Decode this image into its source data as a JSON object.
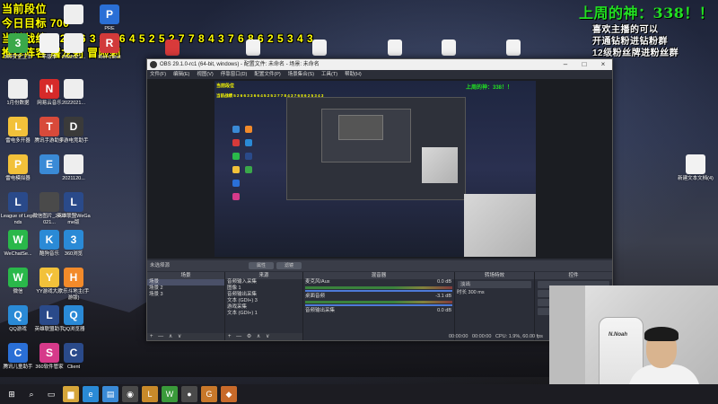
{
  "overlay": {
    "line1": "当前段位",
    "line2": "今日目标 700",
    "line3": "当前战绩 5 2 6 6 3 3 6 6 4 5 2 5 2 7 7 8 4 3 7 6 8 6 2 5 3 4 3",
    "line4": "推荐阵容 屠龙刺 冒险刺",
    "god_title": "上周的神：338！！",
    "right1": "喜欢主播的可以",
    "right2": "开通钻粉进钻粉群",
    "right3": "12级粉丝牌进粉丝群"
  },
  "desktop_icons": [
    {
      "name": "icon-pre",
      "label": "PRE",
      "color": "#2a6fd6",
      "glyph": "P"
    },
    {
      "name": "icon-doc-1",
      "label": "",
      "color": "#eeeeee",
      "glyph": ""
    },
    {
      "name": "icon-360-safe",
      "label": "360安全卫士",
      "color": "#3aa84a",
      "glyph": "3"
    },
    {
      "name": "icon-word",
      "label": "年版本",
      "color": "#f2f2f2",
      "glyph": ""
    },
    {
      "name": "icon-doc-2",
      "label": "2022021...",
      "color": "#eeeeee",
      "glyph": ""
    },
    {
      "name": "icon-riot",
      "label": "Riot Client",
      "color": "#d13a3a",
      "glyph": "R"
    },
    {
      "name": "icon-doc-3",
      "label": "1月份数据",
      "color": "#eeeeee",
      "glyph": ""
    },
    {
      "name": "icon-netease-music",
      "label": "网易云音乐",
      "color": "#d62a2a",
      "glyph": "N"
    },
    {
      "name": "icon-doc-4",
      "label": "2022021...",
      "color": "#eeeeee",
      "glyph": ""
    },
    {
      "name": "icon-store",
      "label": "雷电多开器",
      "color": "#f2c13a",
      "glyph": "L"
    },
    {
      "name": "icon-tencent",
      "label": "腾讯手游助手",
      "color": "#d84a3a",
      "glyph": "T"
    },
    {
      "name": "icon-huya",
      "label": "多游电竞助手",
      "color": "#3a3a3a",
      "glyph": "D"
    },
    {
      "name": "icon-leidian",
      "label": "雷电模拟器",
      "color": "#f2c13a",
      "glyph": "P"
    },
    {
      "name": "icon-earth",
      "label": "",
      "color": "#3a8ad6",
      "glyph": "E"
    },
    {
      "name": "icon-doc-5",
      "label": "2021120...",
      "color": "#eeeeee",
      "glyph": ""
    },
    {
      "name": "icon-lol",
      "label": "League of Legends",
      "color": "#2a4a8a",
      "glyph": "L"
    },
    {
      "name": "icon-wechat-img",
      "label": "微信图片_2022021...",
      "color": "#4a4a4a",
      "glyph": ""
    },
    {
      "name": "icon-lol-client",
      "label": "英雄联盟WeGame版",
      "color": "#2a4a8a",
      "glyph": "L"
    },
    {
      "name": "icon-wechat-se",
      "label": "WeChatSe...",
      "color": "#2ab84a",
      "glyph": "W"
    },
    {
      "name": "icon-kugou",
      "label": "酷狗音乐",
      "color": "#2a8ad6",
      "glyph": "K"
    },
    {
      "name": "icon-360-browser",
      "label": "360浏览",
      "color": "#2a8ad6",
      "glyph": "3"
    },
    {
      "name": "icon-wechat",
      "label": "微信",
      "color": "#2ab84a",
      "glyph": "W"
    },
    {
      "name": "icon-yy",
      "label": "YY游戏大厅",
      "color": "#f2c13a",
      "glyph": "Y"
    },
    {
      "name": "icon-happy",
      "label": "欢乐斗地主(手游版)",
      "color": "#f28a2a",
      "glyph": "H"
    },
    {
      "name": "icon-qq-game",
      "label": "QQ游戏",
      "color": "#2a8ad6",
      "glyph": "Q"
    },
    {
      "name": "icon-lol-helper",
      "label": "英雄联盟助手",
      "color": "#2a4a8a",
      "glyph": "L"
    },
    {
      "name": "icon-qq-browser",
      "label": "QQ浏览器",
      "color": "#2a8ad6",
      "glyph": "Q"
    },
    {
      "name": "icon-panel",
      "label": "腾讯儿童助手",
      "color": "#2a6fd6",
      "glyph": "C"
    },
    {
      "name": "icon-360-soft",
      "label": "360软件管家",
      "color": "#d63a8a",
      "glyph": "S"
    },
    {
      "name": "icon-client",
      "label": "Client",
      "color": "#2a4a8a",
      "glyph": "C"
    }
  ],
  "desktop_icons_top": [
    {
      "name": "icon-doc-top-1",
      "label": ""
    },
    {
      "name": "icon-doc-top-2",
      "label": ""
    },
    {
      "name": "icon-doc-top-3",
      "label": ""
    },
    {
      "name": "icon-doc-top-4",
      "label": ""
    },
    {
      "name": "icon-doc-top-5",
      "label": ""
    },
    {
      "name": "icon-doc-top-6",
      "label": ""
    }
  ],
  "new_text_doc": {
    "label": "新建文本文档(4)"
  },
  "obs": {
    "title": "OBS 29.1.0-rc1 (64-bit, windows) - 配置文件: 未命名 - 场景: 未命名",
    "menu": [
      "文件(F)",
      "编辑(E)",
      "视图(V)",
      "停靠窗口(D)",
      "配置文件(P)",
      "场景集合(S)",
      "工具(T)",
      "帮助(H)"
    ],
    "no_source": "未选择源",
    "props_btn": "属性",
    "filter_btn": "滤镜",
    "docks": {
      "scenes": {
        "title": "场景",
        "items": [
          "场景",
          "场景 2",
          "场景 3"
        ],
        "foot": "+ — ∧ ∨"
      },
      "sources": {
        "title": "来源",
        "items": [
          "音频输入采集",
          "图像 1",
          "音频输出采集",
          "文本 (GDI+) 3",
          "游戏采集",
          "文本 (GDI+) 1"
        ],
        "foot": "+ — ⚙ ∧ ∨"
      },
      "mixer": {
        "title": "混音器",
        "ch1": "麦克风/Aux",
        "ch1_db": "0.0 dB",
        "ch2": "桌面音频",
        "ch2_db": "-3.1 dB",
        "ch3": "音频输出采集",
        "ch3_db": "0.0 dB"
      },
      "transitions": {
        "title": "转场特效",
        "fade": "淡出",
        "duration_label": "时长",
        "duration": "300 ms"
      },
      "controls": {
        "title": "控件"
      }
    },
    "status": {
      "live": "00:00:00",
      "rec": "00:00:00",
      "cpu": "CPU: 1.9%, 60.00 fps"
    }
  },
  "webcam": {
    "chair_brand": "N.Noah"
  },
  "taskbar": {
    "items": [
      {
        "name": "start-button",
        "glyph": "⊞",
        "color": "#1c1c22"
      },
      {
        "name": "taskbar-search-icon",
        "glyph": "⌕",
        "color": "#1c1c22"
      },
      {
        "name": "taskbar-taskview-icon",
        "glyph": "▭",
        "color": "#1c1c22"
      },
      {
        "name": "taskbar-explorer-icon",
        "glyph": "▆",
        "color": "#d6a63a"
      },
      {
        "name": "taskbar-edge-icon",
        "glyph": "e",
        "color": "#2a8ad6"
      },
      {
        "name": "taskbar-files-icon",
        "glyph": "▤",
        "color": "#3a8ad6"
      },
      {
        "name": "taskbar-chrome-icon",
        "glyph": "◉",
        "color": "#4a4a4a"
      },
      {
        "name": "taskbar-lol-icon",
        "glyph": "L",
        "color": "#c88a2a"
      },
      {
        "name": "taskbar-wechat-icon",
        "glyph": "W",
        "color": "#3a9a3a"
      },
      {
        "name": "taskbar-obs-icon",
        "glyph": "●",
        "color": "#4a4a4a"
      },
      {
        "name": "taskbar-app1-icon",
        "glyph": "G",
        "color": "#c8782a"
      },
      {
        "name": "taskbar-app2-icon",
        "glyph": "◆",
        "color": "#c86a2a"
      }
    ]
  }
}
